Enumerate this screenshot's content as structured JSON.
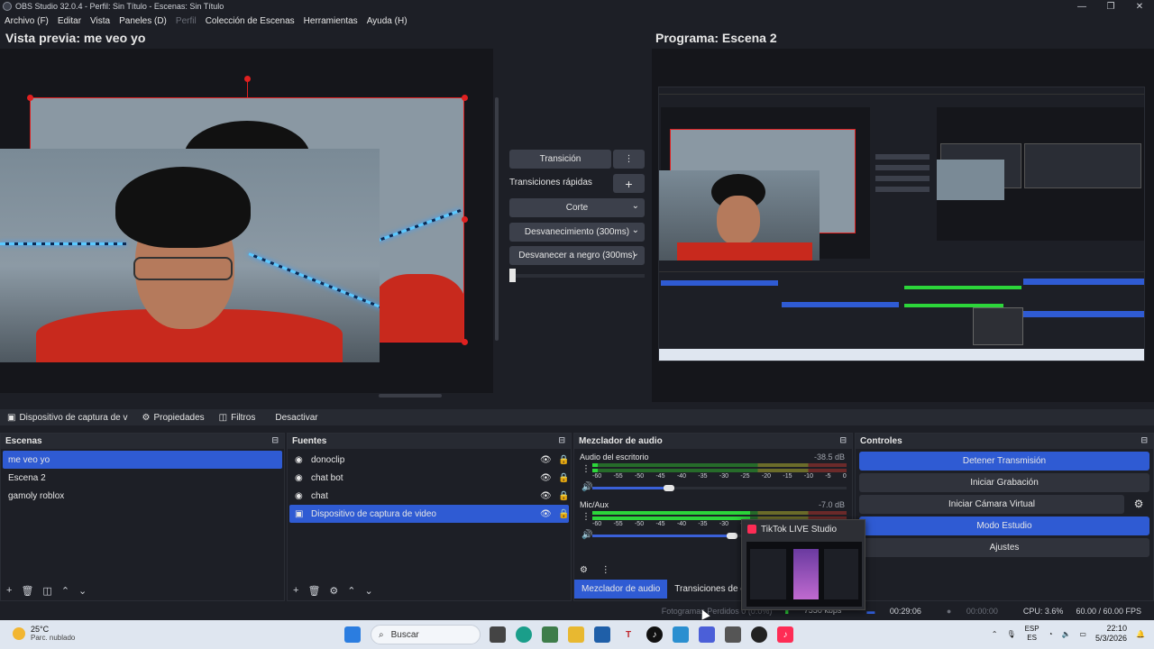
{
  "window": {
    "title": "OBS Studio 32.0.4 - Perfil: Sin Título - Escenas: Sin Título",
    "controls": [
      "—",
      "❐",
      "✕"
    ]
  },
  "menu": [
    "Archivo (F)",
    "Editar",
    "Vista",
    "Paneles (D)",
    "Perfil",
    "Colección de Escenas",
    "Herramientas",
    "Ayuda (H)"
  ],
  "preview": {
    "title": "Vista previa: me veo yo"
  },
  "program": {
    "title": "Programa: Escena 2"
  },
  "transitions": {
    "transition_button": "Transición",
    "quick_label": "Transiciones rápidas",
    "add_symbol": "+",
    "more_symbol": "⋮",
    "options": [
      "Corte",
      "Desvanecimiento (300ms)",
      "Desvanecer a negro (300ms)"
    ]
  },
  "source_bar": {
    "selected_source": "Dispositivo de captura de v",
    "properties": "Propiedades",
    "filters": "Filtros",
    "deactivate": "Desactivar"
  },
  "scenes": {
    "title": "Escenas",
    "items": [
      "me veo yo",
      "Escena 2",
      "gamoly roblox"
    ],
    "selected_index": 0
  },
  "sources": {
    "title": "Fuentes",
    "items": [
      "donoclip",
      "chat bot",
      "chat",
      "Dispositivo de captura de video"
    ],
    "selected_index": 3
  },
  "mixer": {
    "title": "Mezclador de audio",
    "channels": [
      {
        "name": "Audio del escritorio",
        "db": "-38.5 dB",
        "level": 0.02,
        "volume": 0.3
      },
      {
        "name": "Mic/Aux",
        "db": "-7.0 dB",
        "level": 0.62,
        "volume": 0.55
      }
    ],
    "scale": [
      "-60",
      "-55",
      "-50",
      "-45",
      "-40",
      "-35",
      "-30",
      "-25",
      "-20",
      "-15",
      "-10",
      "-5",
      "0"
    ]
  },
  "controls": {
    "title": "Controles",
    "buttons": [
      "Detener Transmisión",
      "Iniciar Grabación",
      "Iniciar Cámara Virtual",
      "Modo Estudio",
      "Ajustes"
    ]
  },
  "tabs": [
    "Mezclador de audio",
    "Transiciones de esce"
  ],
  "status": {
    "frames": "Fotogramas Perdidos 0 (0.0%)",
    "bitrate": "7550 kbps",
    "stream_time": "00:29:06",
    "rec_time": "00:00:00",
    "cpu": "CPU: 3.6%",
    "fps": "60.00 / 60.00 FPS"
  },
  "popup": {
    "title": "TikTok LIVE Studio"
  },
  "taskbar": {
    "temp": "25°C",
    "weather": "Parc. nublado",
    "search_placeholder": "Buscar",
    "lang1": "ESP",
    "lang2": "ES",
    "time": "22:10",
    "date": "5/3/2026"
  },
  "colors": {
    "accent": "#2f5bd3",
    "bg": "#1d1f26",
    "selection_red": "#e02020"
  }
}
